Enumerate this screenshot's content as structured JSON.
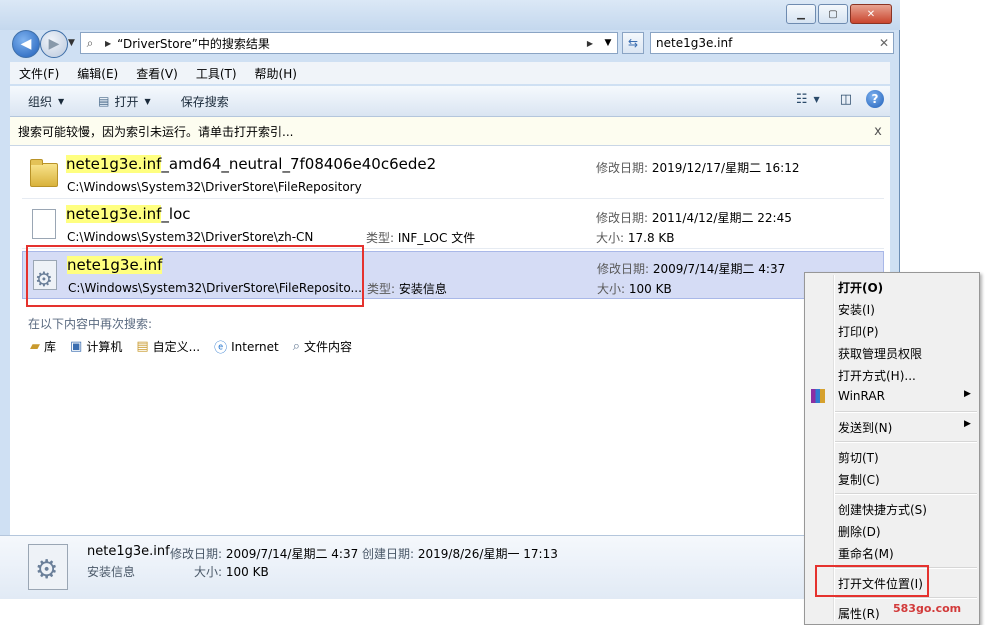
{
  "window": {
    "controls": {
      "minimize": "▁",
      "maximize": "▢",
      "close": "✕"
    }
  },
  "nav": {
    "back": "◀",
    "forward": "▶",
    "address_path": "“DriverStore”中的搜索结果",
    "search_value": "nete1g3e.inf"
  },
  "menubar": [
    "文件(F)",
    "编辑(E)",
    "查看(V)",
    "工具(T)",
    "帮助(H)"
  ],
  "toolbar": {
    "organize": "组织",
    "open": "打开",
    "save_search": "保存搜索"
  },
  "infobar": {
    "text": "搜索可能较慢，因为索引未运行。请单击打开索引...",
    "close": "x"
  },
  "results": [
    {
      "name_hl": "nete1g3e.inf",
      "name_rest": "_amd64_neutral_7f08406e40c6ede2",
      "location": "C:\\Windows\\System32\\DriverStore\\FileRepository",
      "modified_label": "修改日期:",
      "modified": "2019/12/17/星期二 16:12"
    },
    {
      "name_hl": "nete1g3e.inf",
      "name_rest": "_loc",
      "location": "C:\\Windows\\System32\\DriverStore\\zh-CN",
      "type_label": "类型:",
      "type": "INF_LOC 文件",
      "modified_label": "修改日期:",
      "modified": "2011/4/12/星期二 22:45",
      "size_label": "大小:",
      "size": "17.8 KB"
    },
    {
      "name_hl": "nete1g3e.inf",
      "name_rest": "",
      "location": "C:\\Windows\\System32\\DriverStore\\FileReposito...",
      "type_label": "类型:",
      "type": "安装信息",
      "modified_label": "修改日期:",
      "modified": "2009/7/14/星期二 4:37",
      "size_label": "大小:",
      "size": "100 KB"
    }
  ],
  "search_again": {
    "label": "在以下内容中再次搜索:",
    "items": [
      "库",
      "计算机",
      "自定义...",
      "Internet",
      "文件内容"
    ]
  },
  "details": {
    "name": "nete1g3e.inf",
    "modified_label": "修改日期:",
    "modified": "2009/7/14/星期二 4:37",
    "created_label": "创建日期:",
    "created": "2019/8/26/星期一 17:13",
    "type": "安装信息",
    "size_label": "大小:",
    "size": "100 KB"
  },
  "context_menu": {
    "open": "打开(O)",
    "install": "安装(I)",
    "print": "打印(P)",
    "take_ownership": "获取管理员权限",
    "open_with": "打开方式(H)...",
    "winrar": "WinRAR",
    "send_to": "发送到(N)",
    "cut": "剪切(T)",
    "copy": "复制(C)",
    "create_shortcut": "创建快捷方式(S)",
    "delete": "删除(D)",
    "rename": "重命名(M)",
    "open_file_location": "打开文件位置(I)",
    "properties": "属性(R)"
  },
  "watermark": "583go.com"
}
